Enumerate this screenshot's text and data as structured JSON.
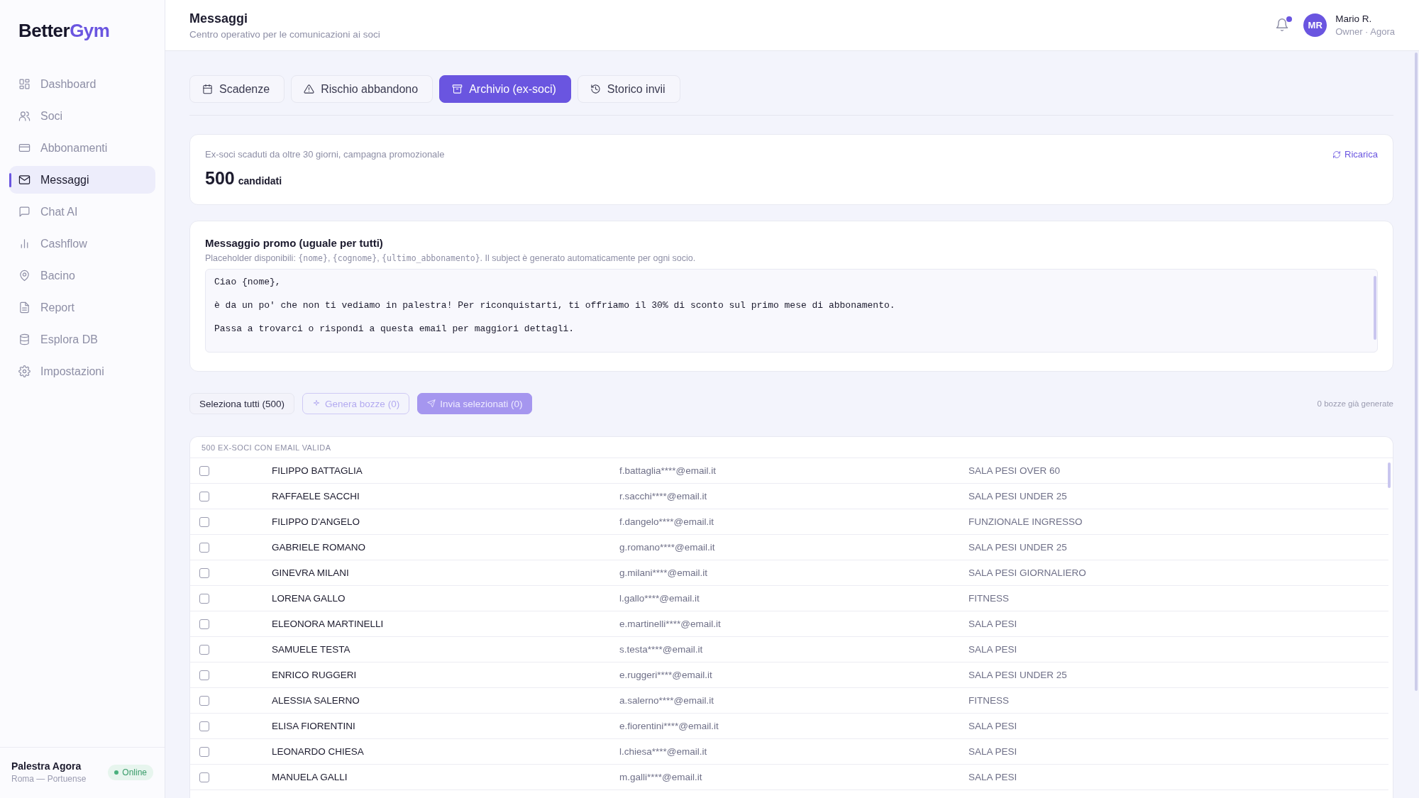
{
  "sidebar": {
    "logo": {
      "part_1": "Better",
      "part_2": "Gym"
    },
    "items": [
      {
        "label": "Dashboard",
        "selected": false
      },
      {
        "label": "Soci",
        "selected": false
      },
      {
        "label": "Abbonamenti",
        "selected": false
      },
      {
        "label": "Messaggi",
        "selected": true
      },
      {
        "label": "Chat AI",
        "selected": false
      },
      {
        "label": "Cashflow",
        "selected": false
      },
      {
        "label": "Bacino",
        "selected": false
      },
      {
        "label": "Report",
        "selected": false
      },
      {
        "label": "Esplora DB",
        "selected": false
      },
      {
        "label": "Impostazioni",
        "selected": false
      }
    ],
    "footer": {
      "name": "Palestra Agora",
      "location": "Roma — Portuense",
      "status": "Online"
    }
  },
  "header": {
    "title": "Messaggi",
    "subtitle": "Centro operativo per le comunicazioni ai soci",
    "notifications_unread": true,
    "user": {
      "initials": "MR",
      "name": "Mario R.",
      "role": "Owner · Agora"
    }
  },
  "tabs": [
    {
      "label": "Scadenze",
      "selected": false
    },
    {
      "label": "Rischio abbandono",
      "selected": false
    },
    {
      "label": "Archivio (ex-soci)",
      "selected": true
    },
    {
      "label": "Storico invii",
      "selected": false
    }
  ],
  "summary": {
    "caption": "Ex-soci scaduti da oltre 30 giorni, campagna promozionale",
    "count": "500",
    "count_label": "candidati",
    "reload": "Ricarica"
  },
  "message": {
    "title": "Messaggio promo (uguale per tutti)",
    "hint_parts": [
      {
        "kind": "text",
        "text": "Placeholder disponibili: "
      },
      {
        "kind": "code",
        "text": "{nome}"
      },
      {
        "kind": "text",
        "text": ", "
      },
      {
        "kind": "code",
        "text": "{cognome}"
      },
      {
        "kind": "text",
        "text": ", "
      },
      {
        "kind": "code",
        "text": "{ultimo_abbonamento}"
      },
      {
        "kind": "text",
        "text": ". Il subject è generato automaticamente per ogni socio."
      }
    ],
    "value": "Ciao {nome},\n\nè da un po' che non ti vediamo in palestra! Per riconquistarti, ti offriamo il 30% di sconto sul primo mese di abbonamento.\n\nPassa a trovarci o rispondi a questa email per maggiori dettagli."
  },
  "actions": {
    "select_all": "Seleziona tutti (500)",
    "generate": {
      "label": "Genera bozze (0)",
      "disabled": true
    },
    "send": {
      "label": "Invia selezionati (0)",
      "disabled": true
    },
    "drafts_note": "0 bozze già generate"
  },
  "table": {
    "caption": "500 EX-SOCI CON EMAIL VALIDA",
    "rows": [
      {
        "checked": false,
        "name": "FILIPPO BATTAGLIA",
        "email": "f.battaglia****@email.it",
        "plan": "SALA PESI OVER 60"
      },
      {
        "checked": false,
        "name": "RAFFAELE SACCHI",
        "email": "r.sacchi****@email.it",
        "plan": "SALA PESI UNDER 25"
      },
      {
        "checked": false,
        "name": "FILIPPO D'ANGELO",
        "email": "f.dangelo****@email.it",
        "plan": "FUNZIONALE INGRESSO"
      },
      {
        "checked": false,
        "name": "GABRIELE ROMANO",
        "email": "g.romano****@email.it",
        "plan": "SALA PESI UNDER 25"
      },
      {
        "checked": false,
        "name": "GINEVRA MILANI",
        "email": "g.milani****@email.it",
        "plan": "SALA PESI GIORNALIERO"
      },
      {
        "checked": false,
        "name": "LORENA GALLO",
        "email": "l.gallo****@email.it",
        "plan": "FITNESS"
      },
      {
        "checked": false,
        "name": "ELEONORA MARTINELLI",
        "email": "e.martinelli****@email.it",
        "plan": "SALA PESI"
      },
      {
        "checked": false,
        "name": "SAMUELE TESTA",
        "email": "s.testa****@email.it",
        "plan": "SALA PESI"
      },
      {
        "checked": false,
        "name": "ENRICO RUGGERI",
        "email": "e.ruggeri****@email.it",
        "plan": "SALA PESI UNDER 25"
      },
      {
        "checked": false,
        "name": "ALESSIA SALERNO",
        "email": "a.salerno****@email.it",
        "plan": "FITNESS"
      },
      {
        "checked": false,
        "name": "ELISA FIORENTINI",
        "email": "e.fiorentini****@email.it",
        "plan": "SALA PESI"
      },
      {
        "checked": false,
        "name": "LEONARDO CHIESA",
        "email": "l.chiesa****@email.it",
        "plan": "SALA PESI"
      },
      {
        "checked": false,
        "name": "MANUELA GALLI",
        "email": "m.galli****@email.it",
        "plan": "SALA PESI"
      }
    ]
  }
}
